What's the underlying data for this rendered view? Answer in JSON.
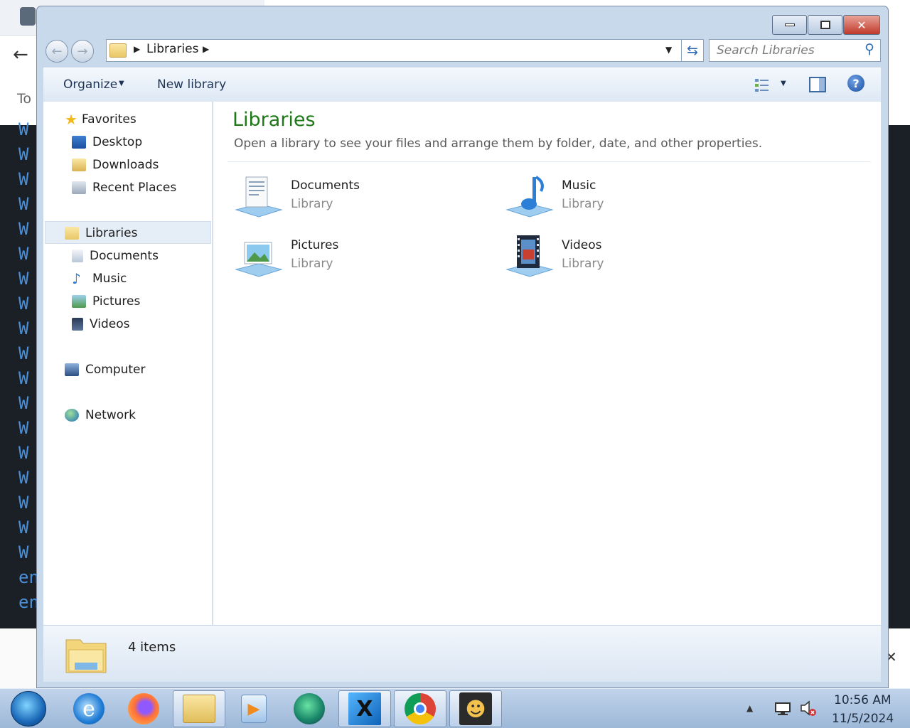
{
  "background": {
    "to_label": "To",
    "side_letters": [
      "W",
      "W",
      "W",
      "W",
      "W",
      "W",
      "W",
      "W",
      "W",
      "W",
      "W",
      "W",
      "W",
      "W",
      "W",
      "W",
      "W",
      "W",
      "en",
      "en"
    ]
  },
  "window": {
    "controls": {
      "minimize": "▭",
      "maximize": "□",
      "close": "✕"
    }
  },
  "address": {
    "root_label": "Libraries"
  },
  "search": {
    "placeholder": "Search Libraries"
  },
  "toolbar": {
    "organize_label": "Organize",
    "new_library_label": "New library"
  },
  "nav": {
    "favorites": {
      "label": "Favorites",
      "items": [
        "Desktop",
        "Downloads",
        "Recent Places"
      ]
    },
    "libraries": {
      "label": "Libraries",
      "items": [
        "Documents",
        "Music",
        "Pictures",
        "Videos"
      ]
    },
    "computer": "Computer",
    "network": "Network"
  },
  "content": {
    "title": "Libraries",
    "subtitle": "Open a library to see your files and arrange them by folder, date, and other properties.",
    "libraries": [
      {
        "name": "Documents",
        "type": "Library",
        "icon": "documents-icon"
      },
      {
        "name": "Music",
        "type": "Library",
        "icon": "music-icon"
      },
      {
        "name": "Pictures",
        "type": "Library",
        "icon": "pictures-icon"
      },
      {
        "name": "Videos",
        "type": "Library",
        "icon": "videos-icon"
      }
    ]
  },
  "status": {
    "count": "4 items"
  },
  "taskbar": {
    "apps": [
      "internet-explorer",
      "firefox",
      "windows-explorer",
      "media-player",
      "edge-like-app",
      "text-editor",
      "chrome",
      "game-app"
    ],
    "active": "windows-explorer"
  },
  "clock": {
    "time": "10:56 AM",
    "date": "11/5/2024"
  },
  "colors": {
    "title_green": "#1d7a16",
    "window_frame": "#c9d9ec",
    "taskbar": "#9db8d8",
    "close_red": "#c0392b"
  }
}
